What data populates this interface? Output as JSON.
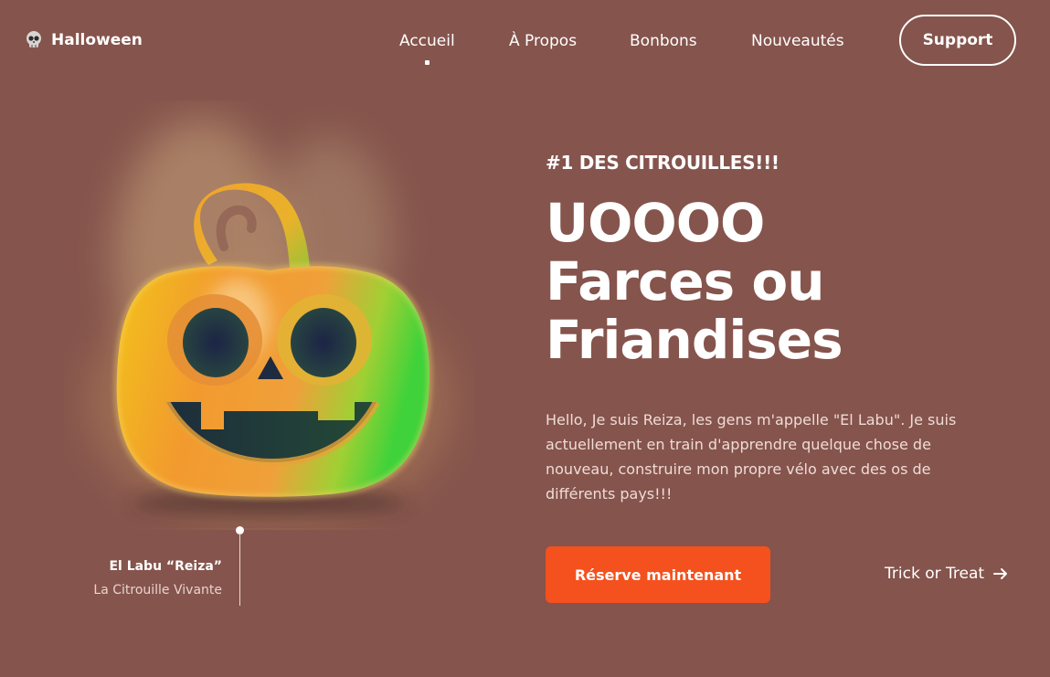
{
  "header": {
    "brand": "Halloween",
    "nav": [
      {
        "label": "Accueil",
        "active": true
      },
      {
        "label": "À Propos",
        "active": false
      },
      {
        "label": "Bonbons",
        "active": false
      },
      {
        "label": "Nouveautés",
        "active": false
      }
    ],
    "support_label": "Support"
  },
  "hero": {
    "eyebrow": "#1 DES CITROUILLES!!!",
    "headline": [
      "UOOOO",
      "Farces ou",
      "Friandises"
    ],
    "description": "Hello, Je suis Reiza, les gens m'appelle \"El Labu\". Je suis actuellement en train d'apprendre quelque chose de nouveau, construire mon propre vélo avec des os de différents pays!!!",
    "cta_label": "Réserve maintenant",
    "secondary_link": "Trick or Treat"
  },
  "character": {
    "name": "El Labu “Reiza”",
    "subtitle": "La Citrouille Vivante"
  },
  "colors": {
    "background": "#85544c",
    "accent": "#f4511e",
    "text": "#ffffff"
  },
  "icons": {
    "brand": "skull-icon",
    "secondary_link": "arrow-right-icon",
    "illustration": "jack-o-lantern-icon"
  }
}
